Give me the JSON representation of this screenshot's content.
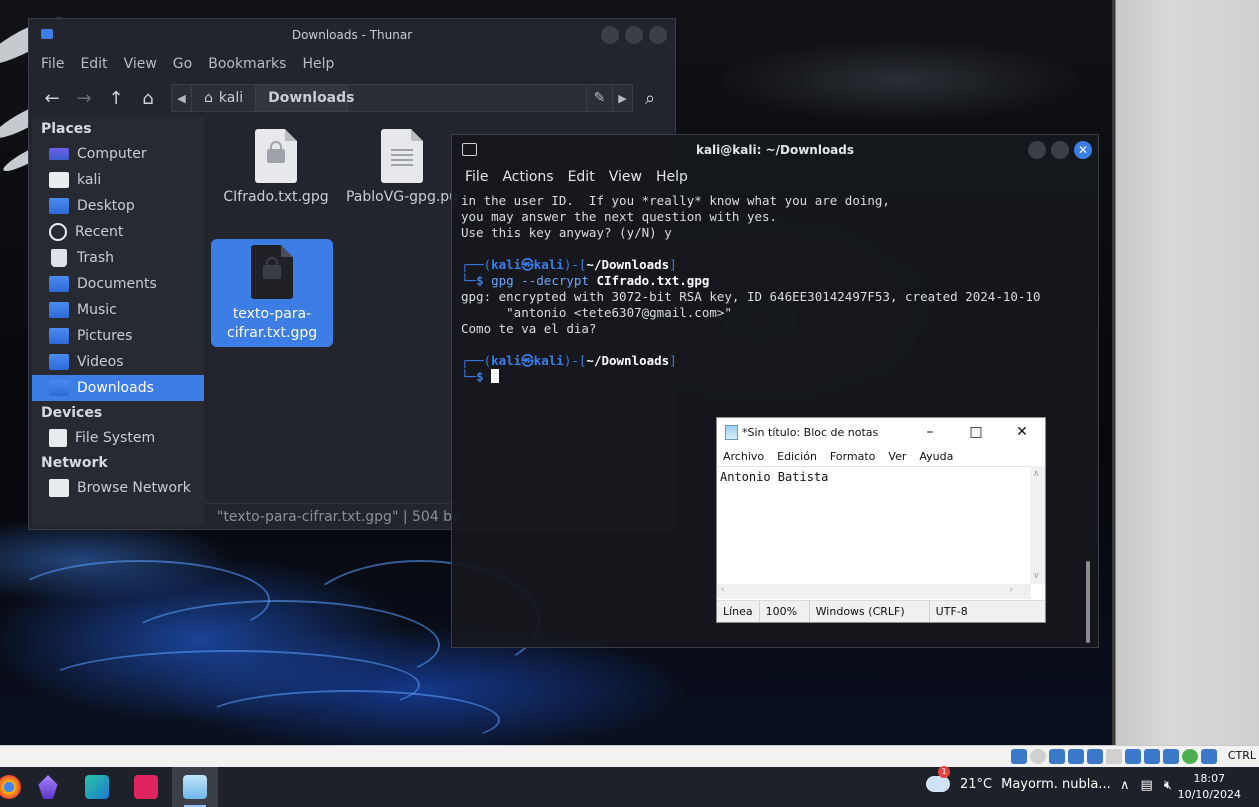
{
  "thunar": {
    "title": "Downloads - Thunar",
    "menu": [
      "File",
      "Edit",
      "View",
      "Go",
      "Bookmarks",
      "Help"
    ],
    "path": {
      "home": "kali",
      "current": "Downloads"
    },
    "sidebar": {
      "places_heading": "Places",
      "places": [
        "Computer",
        "kali",
        "Desktop",
        "Recent",
        "Trash",
        "Documents",
        "Music",
        "Pictures",
        "Videos",
        "Downloads"
      ],
      "devices_heading": "Devices",
      "devices": [
        "File System"
      ],
      "network_heading": "Network",
      "network": [
        "Browse Network"
      ]
    },
    "files": [
      {
        "name": "CIfrado.txt.gpg",
        "icon": "lock-document-icon"
      },
      {
        "name": "PabloVG-gpg.pu",
        "icon": "text-document-icon"
      },
      {
        "name": "texto-para-cifrar.txt.gpg",
        "icon": "lock-document-icon",
        "selected": true
      }
    ],
    "status": "\"texto-para-cifrar.txt.gpg\" | 504 by"
  },
  "terminal": {
    "title": "kali@kali: ~/Downloads",
    "menu": [
      "File",
      "Actions",
      "Edit",
      "View",
      "Help"
    ],
    "lines": [
      "in the user ID.  If you *really* know what you are doing,",
      "you may answer the next question with yes.",
      "",
      "Use this key anyway? (y/N) y"
    ],
    "prompt1": {
      "user": "kali",
      "at": "㉿",
      "host": "kali",
      "dir": "~/Downloads",
      "cmd": "gpg",
      "opt": "--decrypt",
      "arg": "CIfrado.txt.gpg"
    },
    "output": [
      "gpg: encrypted with 3072-bit RSA key, ID 646EE30142497F53, created 2024-10-10",
      "      \"antonio <tete6307@gmail.com>\"",
      "Como te va el dia?"
    ],
    "prompt2": {
      "user": "kali",
      "at": "㉿",
      "host": "kali",
      "dir": "~/Downloads"
    }
  },
  "notepad": {
    "title": "*Sin título: Bloc de notas",
    "menu": [
      "Archivo",
      "Edición",
      "Formato",
      "Ver",
      "Ayuda"
    ],
    "content": "Antonio Batista",
    "status": {
      "position": "Línea",
      "zoom": "100%",
      "eol": "Windows (CRLF)",
      "encoding": "UTF-8"
    }
  },
  "vmbar": {
    "key": "CTRL"
  },
  "taskbar": {
    "weather": {
      "temp": "21°C",
      "desc": "Mayorm. nubla...",
      "badge": "1"
    },
    "clock": {
      "time": "18:07",
      "date": "10/10/2024"
    }
  },
  "colors": {
    "accent": "#3d7de6",
    "terminal_bg": "#16181d",
    "thunar_bg": "#22252c"
  }
}
